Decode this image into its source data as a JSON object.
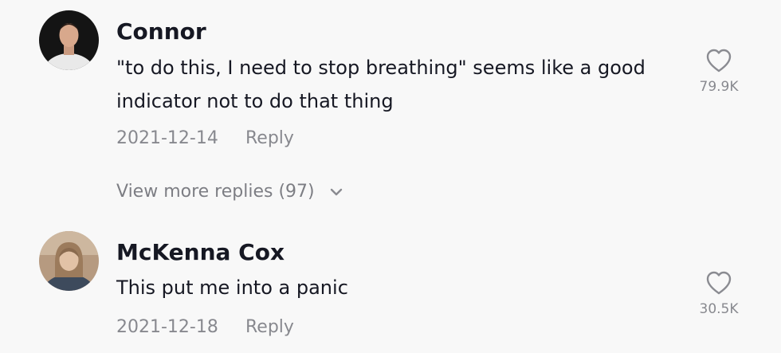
{
  "comments": [
    {
      "username": "Connor",
      "text": "\"to do this, I need to stop breathing\" seems like a good indicator not to do that thing",
      "date": "2021-12-14",
      "reply_label": "Reply",
      "like_count": "79.9K",
      "view_more_replies_label": "View more replies (97)"
    },
    {
      "username": "McKenna Cox",
      "text": "This put me into a panic",
      "date": "2021-12-18",
      "reply_label": "Reply",
      "like_count": "30.5K"
    }
  ],
  "icons": {
    "like": "heart-outline-icon",
    "expand": "chevron-down-icon"
  },
  "colors": {
    "background": "#f8f8f8",
    "primary_text": "#161823",
    "secondary_text": "#8a8b91"
  }
}
